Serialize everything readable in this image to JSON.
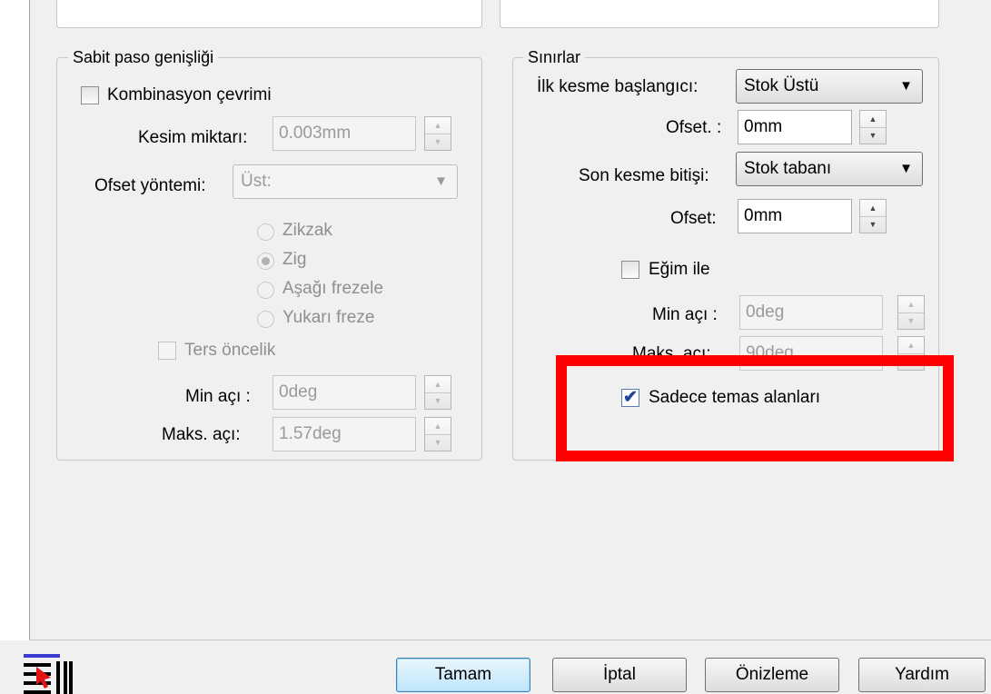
{
  "left_group": {
    "title": "Sabit paso genişliği",
    "combination_cycle_label": "Kombinasyon çevrimi",
    "cut_amount_label": "Kesim miktarı:",
    "cut_amount_value": "0.003mm",
    "offset_method_label": "Ofset yöntemi:",
    "offset_method_value": "Üst:",
    "radios": [
      {
        "label": "Zikzak",
        "selected": false
      },
      {
        "label": "Zig",
        "selected": true
      },
      {
        "label": "Aşağı frezele",
        "selected": false
      },
      {
        "label": "Yukarı freze",
        "selected": false
      }
    ],
    "reverse_priority_label": "Ters öncelik",
    "min_angle_label": "Min açı :",
    "min_angle_value": "0deg",
    "max_angle_label": "Maks. açı:",
    "max_angle_value": "1.57deg"
  },
  "right_group": {
    "title": "Sınırlar",
    "first_cut_start_label": "İlk kesme başlangıcı:",
    "first_cut_start_value": "Stok Üstü",
    "offset1_label": "Ofset. :",
    "offset1_value": "0mm",
    "last_cut_end_label": "Son kesme bitişi:",
    "last_cut_end_value": "Stok tabanı",
    "offset2_label": "Ofset:",
    "offset2_value": "0mm",
    "slope_label": "Eğim ile",
    "min_angle_label": "Min açı :",
    "min_angle_value": "0deg",
    "max_angle_label": "Maks. açı:",
    "max_angle_value": "90deg",
    "contact_only_label": "Sadece temas alanları",
    "contact_only_checked": true
  },
  "buttons": {
    "ok": "Tamam",
    "cancel": "İptal",
    "preview": "Önizleme",
    "help": "Yardım"
  },
  "icons": {
    "table_tool": "table-cursor-icon",
    "spin_up": "▲",
    "spin_down": "▼",
    "dropdown": "▼",
    "check": "✔"
  },
  "colors": {
    "highlight": "#ff0000",
    "default_button": "#bee6fd"
  }
}
